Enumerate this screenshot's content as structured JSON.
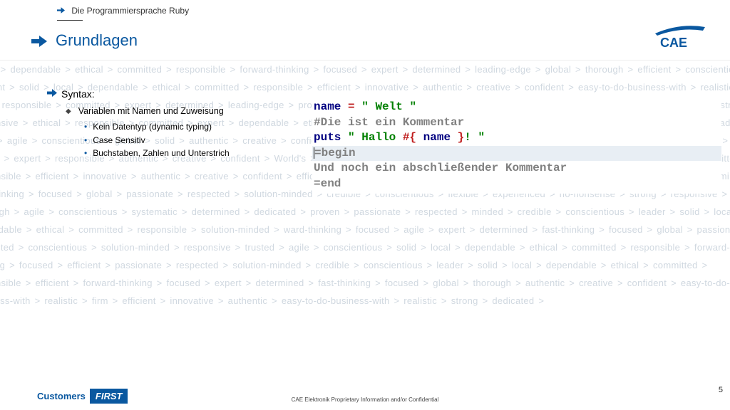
{
  "breadcrumb": "Die Programmiersprache Ruby",
  "title": "Grundlagen",
  "heading": "Syntax:",
  "sub": "Variablen mit Namen und Zuweisung",
  "bullets": [
    "Kein Datentyp (dynamic typing)",
    "Case Sensitiv",
    "Buchstaben, Zahlen und Unterstrich"
  ],
  "code": {
    "l1a": "name",
    "l1b": "=",
    "l1c": "\" Welt \"",
    "l2": "#Die ist ein Kommentar",
    "l3a": "puts ",
    "l3b": "\" Hallo ",
    "l3c": "#{",
    "l3d": " name ",
    "l3e": "}",
    "l3f": "! \"",
    "l4": "=begin",
    "l5": "   Und noch ein abschließender Kommentar",
    "l6": "=end"
  },
  "footer": {
    "c": "Customers",
    "f": "FIRST",
    "conf": "CAE Elektronik Proprietary Information and/or Confidential",
    "page": "5"
  },
  "logo": "CAE",
  "bgwords": "proud > dependable > ethical > committed > responsible > forward-thinking > focused > expert > determined > leading-edge > global > thorough > efficient > conscientious > efficient > solid > local > dependable > ethical > committed > responsible > efficient > innovative > authentic > creative > confident > easy-to-do-business-with > realistic > firm > responsible > committed > expert > determined > leading-edge > prompt > pioneer > strong > dedicated > motivating > proud > experienced > no-nonsense > strong > responsive > ethical > responsible > committed > expert > dependable > ethical > fast-thinking > focused > solution-led > solution-minded > smart > fast-thinking > leading-edge > agile > conscientious > global > solid > authentic > creative > confident > easy-to-do-business-with > realistic > leader > determined > dedicated > motivating > ethical > expert > responsible > authentic > creative > confident > World's > solution-minded > credible > conscientious > leader-solid > dependable > ethical > committed > responsible > efficient > innovative > authentic > creative > confident > efficient > authentic > solid > proud > experienced > leading-edge > focused > expert > determined > fast-thinking > focused > global > passionate > respected > solution-minded > credible > conscientious > flexible > experienced > no-nonsense > strong > responsive > thorough > agile > conscientious > systematic > determined > dedicated > proven > passionate > respected > minded > credible > conscientious > leader > solid > local > dependable > ethical > committed > responsible > solution-minded > ward-thinking > focused > agile > expert > determined > fast-thinking > focused > global > passionate > respected > conscientious > solution-minded > responsive > trusted > agile > conscientious > solid > local > dependable > ethical > committed > responsible > forward-thinking > focused > efficient > passionate > respected > solution-minded > credible > conscientious > leader > solid > local > dependable > ethical > committed > responsible > efficient > forward-thinking > focused > expert > determined > fast-thinking > focused > global > thorough > authentic > creative > confident > easy-to-do-business-with > realistic > firm > efficient > innovative > authentic > easy-to-do-business-with > realistic > strong > dedicated >"
}
